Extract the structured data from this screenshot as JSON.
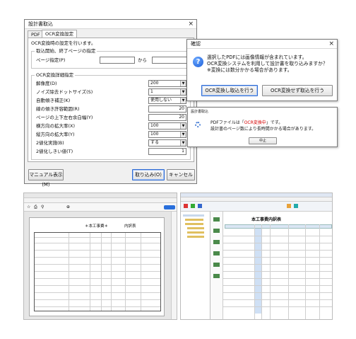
{
  "main_dialog": {
    "title": "設計書取込",
    "close": "×",
    "tabs": [
      "PDF",
      "OCR変換設定"
    ],
    "intro": "OCR変換時の設定を行います。",
    "page_group": {
      "label": "取込開始、終了ページの指定",
      "field_label": "ページ指定(P)",
      "from_value": "",
      "to_label": "から",
      "to_value": ""
    },
    "detail_group": {
      "label": "OCR変換詳細指定",
      "rows": [
        {
          "label": "解像度(D)",
          "value": "200"
        },
        {
          "label": "ノイズ除去ドットサイズ(S)",
          "value": "1"
        },
        {
          "label": "自動傾き補正(K)",
          "value": "使用しない"
        },
        {
          "label": "線の傾き許容範囲(R)",
          "value": "20"
        },
        {
          "label": "ページの上下左右余白幅(Y)",
          "value": "20"
        },
        {
          "label": "横方向の拡大率(X)",
          "value": "100"
        },
        {
          "label": "縦方向の拡大率(Y)",
          "value": "100"
        },
        {
          "label": "2値化実施(B)",
          "value": "する"
        },
        {
          "label": "2値化しきい値(T)",
          "value": "1"
        }
      ]
    },
    "buttons": {
      "manual": "マニュアル表示(M)",
      "import": "取り込み(O)",
      "cancel": "キャンセル"
    }
  },
  "confirm_dialog": {
    "title": "確認",
    "close": "×",
    "icon": "question-icon",
    "lines": [
      "選択したPDFには画像情報が含まれています。",
      "OCR変換システムを利用して設計書を取り込みますか？",
      "※変換には数分かかる場合があります。"
    ],
    "buttons": {
      "ocr": "OCR変換し取込を行う",
      "no_ocr": "OCR変換せず取込を行う"
    }
  },
  "progress_dialog": {
    "title": "設計書取込",
    "line1_pre": "PDFファイルは「",
    "line1_red": "OCR変換中",
    "line1_post": "」です。",
    "line2": "設計書のページ数により長時間かかる場合があります。",
    "cancel": "中止"
  },
  "pdf_viewer": {
    "doc_title": "＊本工事費＊",
    "doc_subtitle": "内訳表"
  },
  "estimate_app": {
    "panel_title": "本工事費内訳表"
  }
}
